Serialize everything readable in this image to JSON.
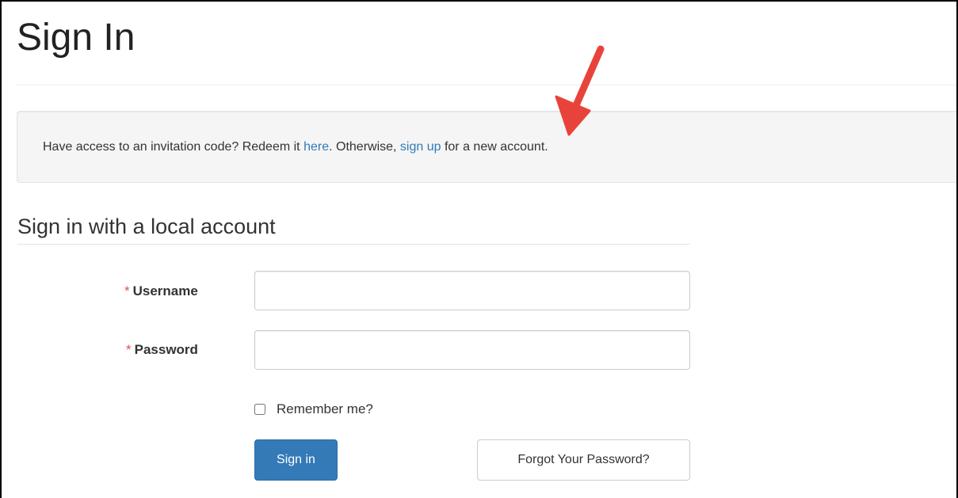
{
  "header": {
    "title": "Sign In"
  },
  "info_box": {
    "text_before_here": "Have access to an invitation code? Redeem it ",
    "here_link": "here",
    "text_middle": ". Otherwise, ",
    "signup_link": "sign up",
    "text_after": " for a new account."
  },
  "login": {
    "section_title": "Sign in with a local account",
    "required_marker": "*",
    "username_label": "Username",
    "username_value": "",
    "password_label": "Password",
    "password_value": "",
    "remember_label": "Remember me?",
    "remember_checked": false,
    "signin_button": "Sign in",
    "forgot_button": "Forgot Your Password?"
  },
  "annotation": {
    "arrow_color": "#e8433b"
  },
  "colors": {
    "link": "#337ab7",
    "primary_button": "#337ab7",
    "required": "#d9534f"
  }
}
